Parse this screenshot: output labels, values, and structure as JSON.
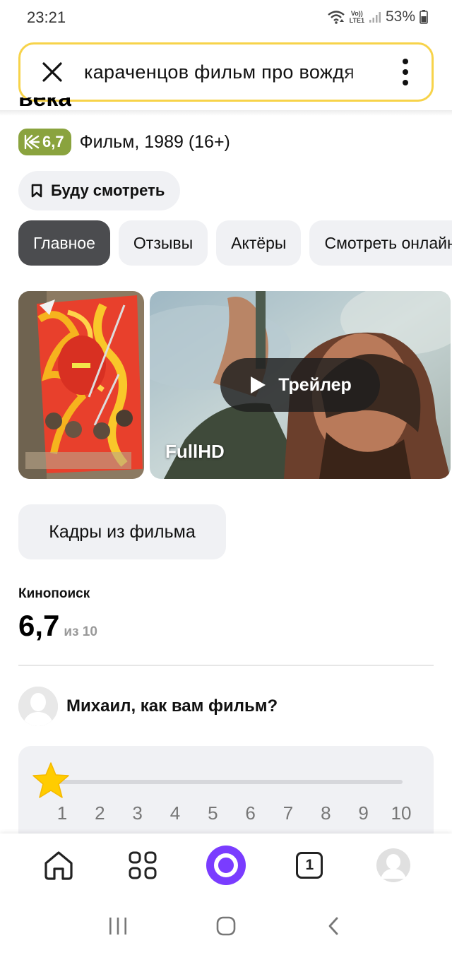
{
  "status_bar": {
    "time": "23:21",
    "network_top": "Vo))",
    "network_bottom": "LTE1",
    "battery": "53%"
  },
  "search": {
    "query": "караченцов фильм про вождя"
  },
  "movie": {
    "title_fragment": "века",
    "rating": "6,7",
    "meta": "Фильм, 1989 (16+)",
    "watch_later": "Буду смотреть"
  },
  "tabs": [
    {
      "label": "Главное",
      "active": true
    },
    {
      "label": "Отзывы",
      "active": false
    },
    {
      "label": "Актёры",
      "active": false
    },
    {
      "label": "Смотреть онлайн",
      "active": false
    }
  ],
  "media": {
    "trailer_label": "Трейлер",
    "quality": "FullHD"
  },
  "frames_button": "Кадры из фильма",
  "kinopoisk": {
    "label": "Кинопоиск",
    "score": "6,7",
    "out_of": "из 10"
  },
  "ask": {
    "question": "Михаил, как вам фильм?"
  },
  "rating_scale": {
    "selected": 1,
    "numbers": [
      "1",
      "2",
      "3",
      "4",
      "5",
      "6",
      "7",
      "8",
      "9",
      "10"
    ]
  },
  "bottom_nav": {
    "tabs_count": "1"
  },
  "colors": {
    "search_border": "#f7d34a",
    "rating_badge": "#8aa33e",
    "active_tab": "#4b4c4f",
    "alice": "#7a3cff",
    "star": "#ffcc00"
  },
  "icons": [
    "wifi-icon",
    "signal-icon",
    "battery-icon",
    "close-icon",
    "more-vertical-icon",
    "kinopoisk-icon",
    "bookmark-icon",
    "play-icon",
    "star-icon",
    "home-icon",
    "services-grid-icon",
    "alice-icon",
    "tabs-icon",
    "profile-icon",
    "recents-icon",
    "home-button-icon",
    "back-icon"
  ]
}
